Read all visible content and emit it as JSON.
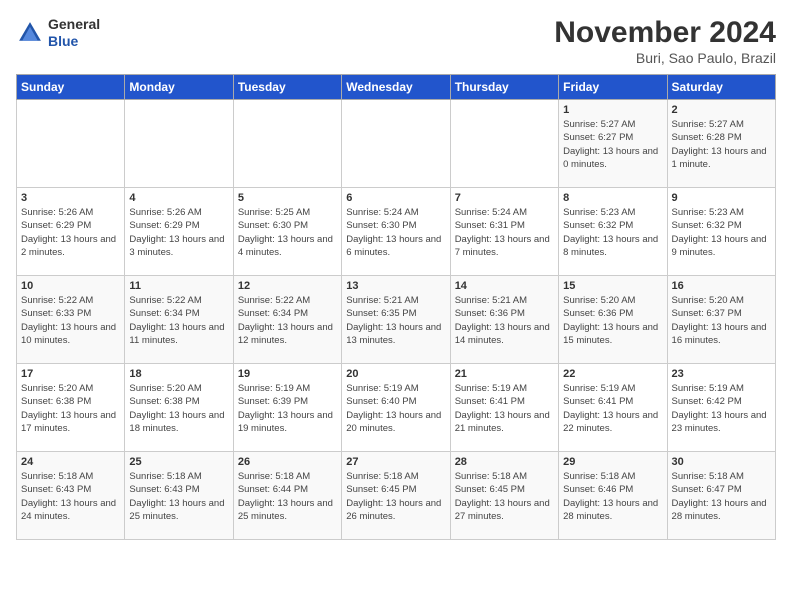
{
  "header": {
    "logo_general": "General",
    "logo_blue": "Blue",
    "month_title": "November 2024",
    "location": "Buri, Sao Paulo, Brazil"
  },
  "weekdays": [
    "Sunday",
    "Monday",
    "Tuesday",
    "Wednesday",
    "Thursday",
    "Friday",
    "Saturday"
  ],
  "weeks": [
    [
      {
        "day": "",
        "info": ""
      },
      {
        "day": "",
        "info": ""
      },
      {
        "day": "",
        "info": ""
      },
      {
        "day": "",
        "info": ""
      },
      {
        "day": "",
        "info": ""
      },
      {
        "day": "1",
        "info": "Sunrise: 5:27 AM\nSunset: 6:27 PM\nDaylight: 13 hours and 0 minutes."
      },
      {
        "day": "2",
        "info": "Sunrise: 5:27 AM\nSunset: 6:28 PM\nDaylight: 13 hours and 1 minute."
      }
    ],
    [
      {
        "day": "3",
        "info": "Sunrise: 5:26 AM\nSunset: 6:29 PM\nDaylight: 13 hours and 2 minutes."
      },
      {
        "day": "4",
        "info": "Sunrise: 5:26 AM\nSunset: 6:29 PM\nDaylight: 13 hours and 3 minutes."
      },
      {
        "day": "5",
        "info": "Sunrise: 5:25 AM\nSunset: 6:30 PM\nDaylight: 13 hours and 4 minutes."
      },
      {
        "day": "6",
        "info": "Sunrise: 5:24 AM\nSunset: 6:30 PM\nDaylight: 13 hours and 6 minutes."
      },
      {
        "day": "7",
        "info": "Sunrise: 5:24 AM\nSunset: 6:31 PM\nDaylight: 13 hours and 7 minutes."
      },
      {
        "day": "8",
        "info": "Sunrise: 5:23 AM\nSunset: 6:32 PM\nDaylight: 13 hours and 8 minutes."
      },
      {
        "day": "9",
        "info": "Sunrise: 5:23 AM\nSunset: 6:32 PM\nDaylight: 13 hours and 9 minutes."
      }
    ],
    [
      {
        "day": "10",
        "info": "Sunrise: 5:22 AM\nSunset: 6:33 PM\nDaylight: 13 hours and 10 minutes."
      },
      {
        "day": "11",
        "info": "Sunrise: 5:22 AM\nSunset: 6:34 PM\nDaylight: 13 hours and 11 minutes."
      },
      {
        "day": "12",
        "info": "Sunrise: 5:22 AM\nSunset: 6:34 PM\nDaylight: 13 hours and 12 minutes."
      },
      {
        "day": "13",
        "info": "Sunrise: 5:21 AM\nSunset: 6:35 PM\nDaylight: 13 hours and 13 minutes."
      },
      {
        "day": "14",
        "info": "Sunrise: 5:21 AM\nSunset: 6:36 PM\nDaylight: 13 hours and 14 minutes."
      },
      {
        "day": "15",
        "info": "Sunrise: 5:20 AM\nSunset: 6:36 PM\nDaylight: 13 hours and 15 minutes."
      },
      {
        "day": "16",
        "info": "Sunrise: 5:20 AM\nSunset: 6:37 PM\nDaylight: 13 hours and 16 minutes."
      }
    ],
    [
      {
        "day": "17",
        "info": "Sunrise: 5:20 AM\nSunset: 6:38 PM\nDaylight: 13 hours and 17 minutes."
      },
      {
        "day": "18",
        "info": "Sunrise: 5:20 AM\nSunset: 6:38 PM\nDaylight: 13 hours and 18 minutes."
      },
      {
        "day": "19",
        "info": "Sunrise: 5:19 AM\nSunset: 6:39 PM\nDaylight: 13 hours and 19 minutes."
      },
      {
        "day": "20",
        "info": "Sunrise: 5:19 AM\nSunset: 6:40 PM\nDaylight: 13 hours and 20 minutes."
      },
      {
        "day": "21",
        "info": "Sunrise: 5:19 AM\nSunset: 6:41 PM\nDaylight: 13 hours and 21 minutes."
      },
      {
        "day": "22",
        "info": "Sunrise: 5:19 AM\nSunset: 6:41 PM\nDaylight: 13 hours and 22 minutes."
      },
      {
        "day": "23",
        "info": "Sunrise: 5:19 AM\nSunset: 6:42 PM\nDaylight: 13 hours and 23 minutes."
      }
    ],
    [
      {
        "day": "24",
        "info": "Sunrise: 5:18 AM\nSunset: 6:43 PM\nDaylight: 13 hours and 24 minutes."
      },
      {
        "day": "25",
        "info": "Sunrise: 5:18 AM\nSunset: 6:43 PM\nDaylight: 13 hours and 25 minutes."
      },
      {
        "day": "26",
        "info": "Sunrise: 5:18 AM\nSunset: 6:44 PM\nDaylight: 13 hours and 25 minutes."
      },
      {
        "day": "27",
        "info": "Sunrise: 5:18 AM\nSunset: 6:45 PM\nDaylight: 13 hours and 26 minutes."
      },
      {
        "day": "28",
        "info": "Sunrise: 5:18 AM\nSunset: 6:45 PM\nDaylight: 13 hours and 27 minutes."
      },
      {
        "day": "29",
        "info": "Sunrise: 5:18 AM\nSunset: 6:46 PM\nDaylight: 13 hours and 28 minutes."
      },
      {
        "day": "30",
        "info": "Sunrise: 5:18 AM\nSunset: 6:47 PM\nDaylight: 13 hours and 28 minutes."
      }
    ]
  ]
}
